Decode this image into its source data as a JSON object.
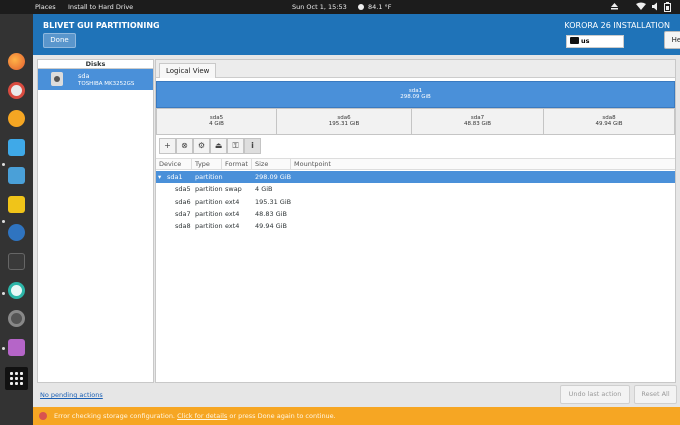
{
  "topbar": {
    "places": "Places",
    "app": "Install to Hard Drive",
    "datetime": "Sun Oct  1, 15:53",
    "weather": "84.1 °F"
  },
  "header": {
    "title": "BLIVET GUI PARTITIONING",
    "done": "Done",
    "installation": "KORORA 26 INSTALLATION",
    "keyboard": "us",
    "help": "Help!"
  },
  "disks": {
    "heading": "Disks",
    "items": [
      {
        "name": "sda",
        "model": "TOSHIBA MK3252GS"
      }
    ]
  },
  "view": {
    "tab": "Logical View",
    "top": {
      "name": "sda1",
      "size": "298.09 GiB"
    },
    "parts": [
      {
        "name": "sda5",
        "size": "4 GiB"
      },
      {
        "name": "sda6",
        "size": "195.31 GiB"
      },
      {
        "name": "sda7",
        "size": "48.83 GiB"
      },
      {
        "name": "sda8",
        "size": "49.94 GiB"
      }
    ]
  },
  "toolbar": [
    "+",
    "⊗",
    "⚙",
    "⏏",
    "⚿",
    "i"
  ],
  "table": {
    "columns": [
      "Device",
      "Type",
      "Format",
      "Size",
      "Mountpoint"
    ],
    "rows": [
      {
        "device": "sda1",
        "type": "partition",
        "format": "",
        "size": "298.09 GiB",
        "mountpoint": ""
      },
      {
        "device": "sda5",
        "type": "partition",
        "format": "swap",
        "size": "4 GiB",
        "mountpoint": ""
      },
      {
        "device": "sda6",
        "type": "partition",
        "format": "ext4",
        "size": "195.31 GiB",
        "mountpoint": ""
      },
      {
        "device": "sda7",
        "type": "partition",
        "format": "ext4",
        "size": "48.83 GiB",
        "mountpoint": ""
      },
      {
        "device": "sda8",
        "type": "partition",
        "format": "ext4",
        "size": "49.94 GiB",
        "mountpoint": ""
      }
    ]
  },
  "bottom": {
    "pending": "No pending actions",
    "undo": "Undo last action",
    "reset": "Reset All"
  },
  "warning": {
    "before": "Error checking storage configuration. ",
    "link": "Click for details",
    "after": " or press Done again to continue."
  },
  "colors": {
    "header": "#1f73b8",
    "selection": "#4a90d9",
    "warning": "#f6a623"
  },
  "dock_icons": [
    "firefox-icon",
    "music-icon",
    "media-player-icon",
    "window-icon",
    "files-icon",
    "folder-icon",
    "software-icon",
    "terminal-icon",
    "installer-icon",
    "settings-icon",
    "documents-icon"
  ]
}
